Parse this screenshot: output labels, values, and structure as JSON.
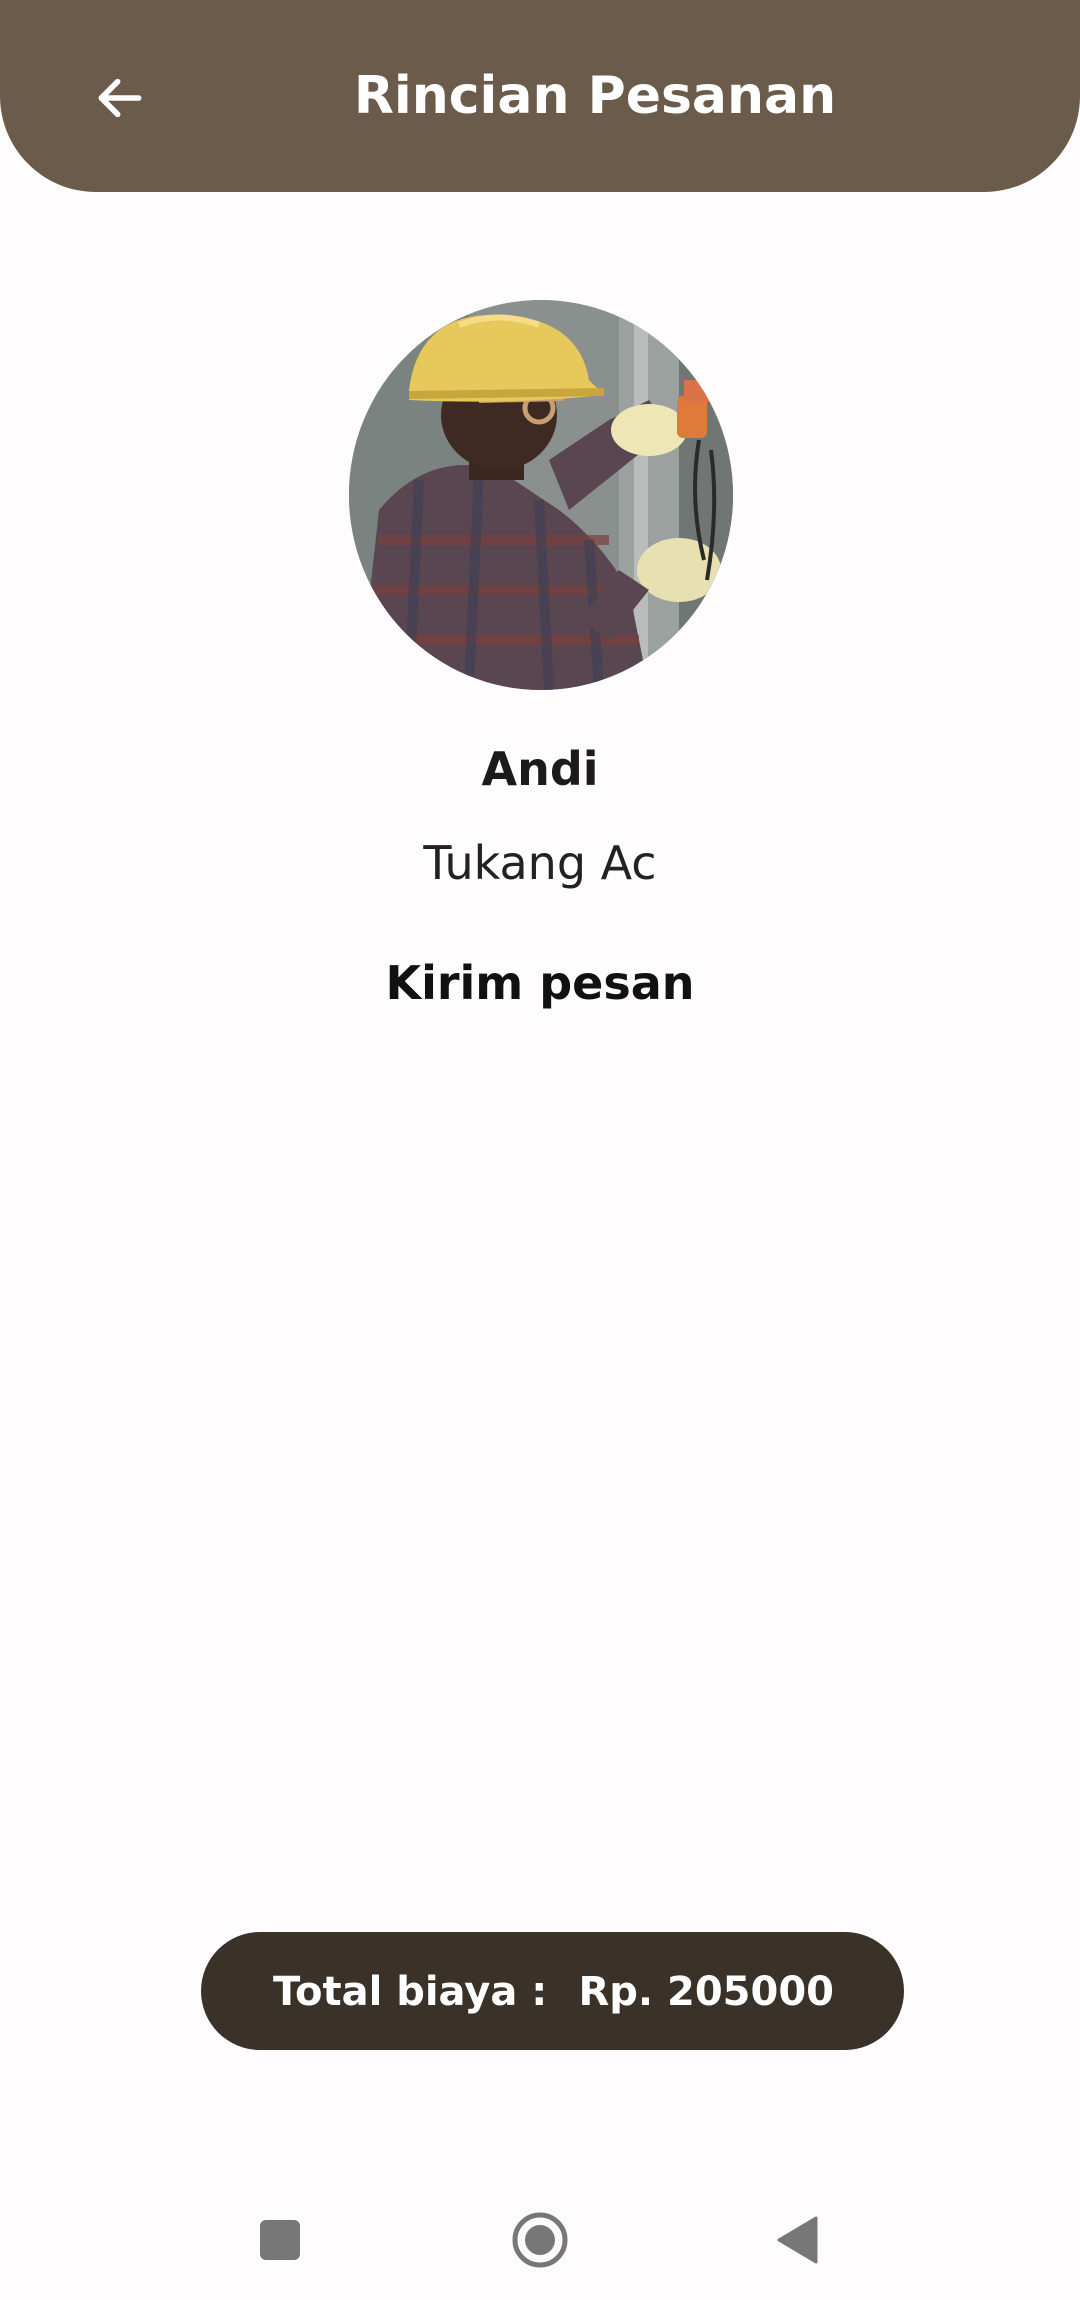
{
  "header": {
    "title": "Rincian Pesanan",
    "back_icon": "arrow-left-icon",
    "background_color": "#6b5b4a"
  },
  "worker": {
    "name": "Andi",
    "role": "Tukang Ac"
  },
  "actions": {
    "send_message_label": "Kirim pesan"
  },
  "total": {
    "label": "Total biaya :",
    "value": "Rp. 205000",
    "background_color": "#3a3128"
  },
  "nav": {
    "recents_icon": "square-icon",
    "home_icon": "circle-icon",
    "back_icon": "triangle-back-icon"
  }
}
